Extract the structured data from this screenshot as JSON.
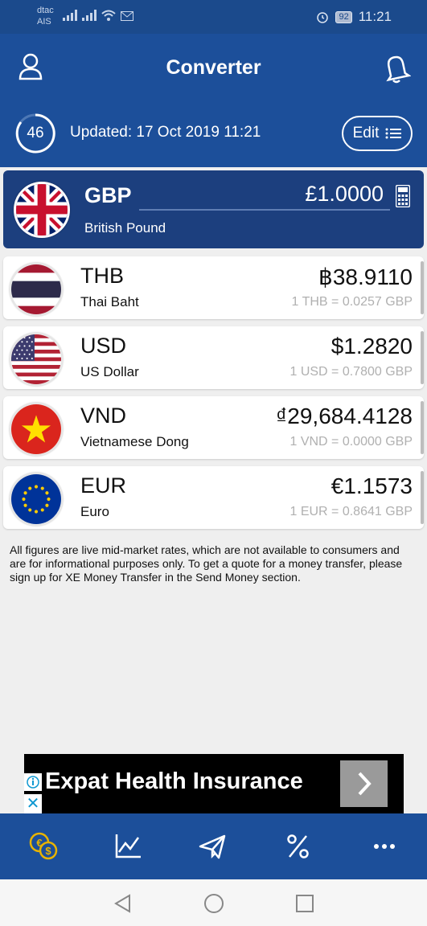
{
  "status_bar": {
    "carrier_1": "dtac",
    "carrier_2": "AIS",
    "battery": "92",
    "time": "11:21"
  },
  "header": {
    "title": "Converter",
    "countdown": "46",
    "updated": "Updated: 17 Oct 2019 11:21",
    "edit_label": "Edit"
  },
  "base": {
    "code": "GBP",
    "name": "British Pound",
    "amount": "£1.0000"
  },
  "currencies": [
    {
      "code": "THB",
      "name": "Thai Baht",
      "amount": "฿38.9110",
      "rate": "1 THB = 0.0257 GBP"
    },
    {
      "code": "USD",
      "name": "US Dollar",
      "amount": "$1.2820",
      "rate": "1 USD = 0.7800 GBP"
    },
    {
      "code": "VND",
      "name": "Vietnamese Dong",
      "amount": "₫29,684.4128",
      "rate": "1 VND = 0.0000 GBP"
    },
    {
      "code": "EUR",
      "name": "Euro",
      "amount": "€1.1573",
      "rate": "1 EUR = 0.8641 GBP"
    }
  ],
  "disclaimer": "All figures are live mid-market rates, which are not available to consumers and are for informational purposes only. To get a quote for a money transfer, please sign up for XE Money Transfer in the Send Money section.",
  "ad": {
    "text": "Expat Health Insurance",
    "close": "✕"
  },
  "bottom_nav": {
    "items": [
      "converter-icon",
      "chart-icon",
      "send-money-icon",
      "rate-alert-icon",
      "more-icon"
    ],
    "active_color": "#e8b300"
  },
  "colors": {
    "header_blue": "#1c4f9a",
    "base_card": "#1c3f7e"
  }
}
